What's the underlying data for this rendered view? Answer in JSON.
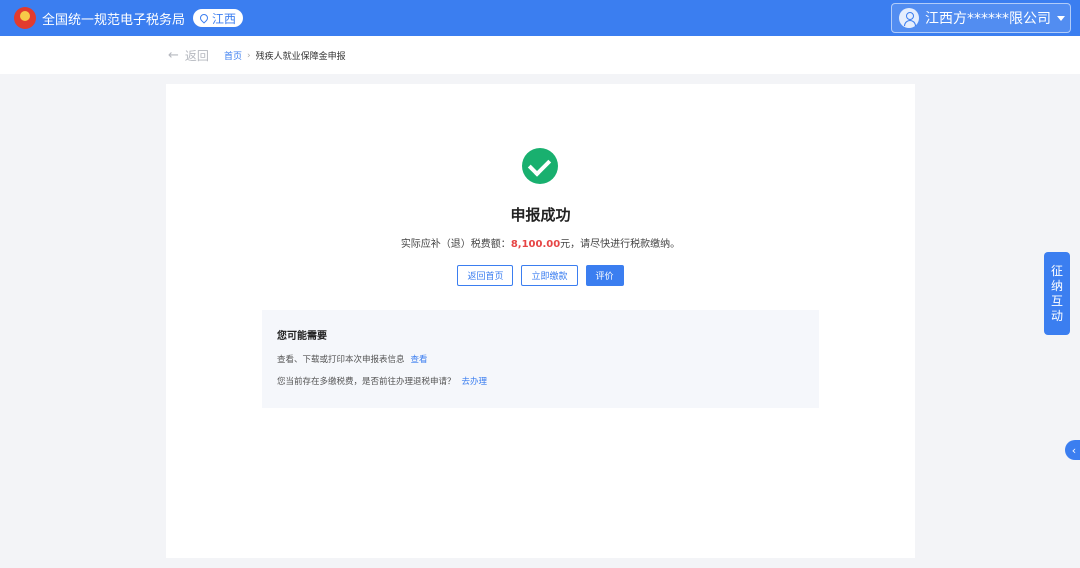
{
  "header": {
    "site_title": "全国统一规范电子税务局",
    "region": "江西",
    "user_name": "江西方******限公司",
    "icons": {
      "logo": "tax-emblem",
      "region": "location-pin-icon",
      "user": "user-avatar-icon",
      "dropdown": "caret-down-icon"
    },
    "bar_color": "#3b7ef0"
  },
  "nav": {
    "back_label": "返回",
    "breadcrumb_home": "首页",
    "breadcrumb_separator": "›",
    "breadcrumb_current": "残疾人就业保障金申报"
  },
  "result": {
    "icon": "check-circle-icon",
    "icon_color": "#19b06f",
    "title": "申报成功",
    "msg_prefix": "实际应补（退）税费额：",
    "amount": "8,100.00",
    "amount_color": "#e64545",
    "msg_suffix": "元，请尽快进行税款缴纳。",
    "buttons": {
      "home": "返回首页",
      "pay": "立即缴款",
      "rate": "评价"
    }
  },
  "suggest": {
    "title": "您可能需要",
    "items": [
      {
        "text": "查看、下载或打印本次申报表信息",
        "link": "查看"
      },
      {
        "text": "您当前存在多缴税费，是否前往办理退税申请？",
        "link": "去办理"
      }
    ]
  },
  "side": {
    "tab_chars": [
      "征",
      "纳",
      "互",
      "动"
    ],
    "collapse_glyph": "‹"
  }
}
